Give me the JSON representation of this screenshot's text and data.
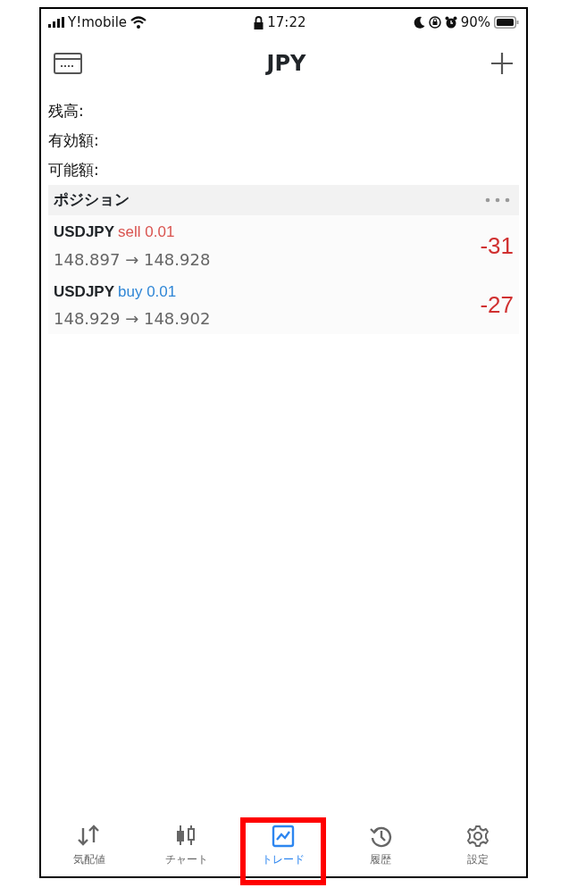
{
  "status_bar": {
    "carrier": "Y!mobile",
    "time": "17:22",
    "battery": "90%"
  },
  "header": {
    "title": "JPY"
  },
  "account": [
    {
      "label": "残高:"
    },
    {
      "label": "有効額:"
    },
    {
      "label": "可能額:"
    }
  ],
  "positions_header": {
    "title": "ポジション"
  },
  "positions": [
    {
      "symbol": "USDJPY",
      "kind": "sell",
      "order": "sell 0.01",
      "prices": "148.897 → 148.928",
      "profit": "-31"
    },
    {
      "symbol": "USDJPY",
      "kind": "buy",
      "order": "buy 0.01",
      "prices": "148.929 → 148.902",
      "profit": "-27"
    }
  ],
  "tabs": [
    {
      "kind": "quotes",
      "label": "気配値",
      "selected": false,
      "highlighted": false
    },
    {
      "kind": "chart",
      "label": "チャート",
      "selected": false,
      "highlighted": false
    },
    {
      "kind": "trade",
      "label": "トレード",
      "selected": true,
      "highlighted": true
    },
    {
      "kind": "history",
      "label": "履歴",
      "selected": false,
      "highlighted": false
    },
    {
      "kind": "settings",
      "label": "設定",
      "selected": false,
      "highlighted": false
    }
  ]
}
